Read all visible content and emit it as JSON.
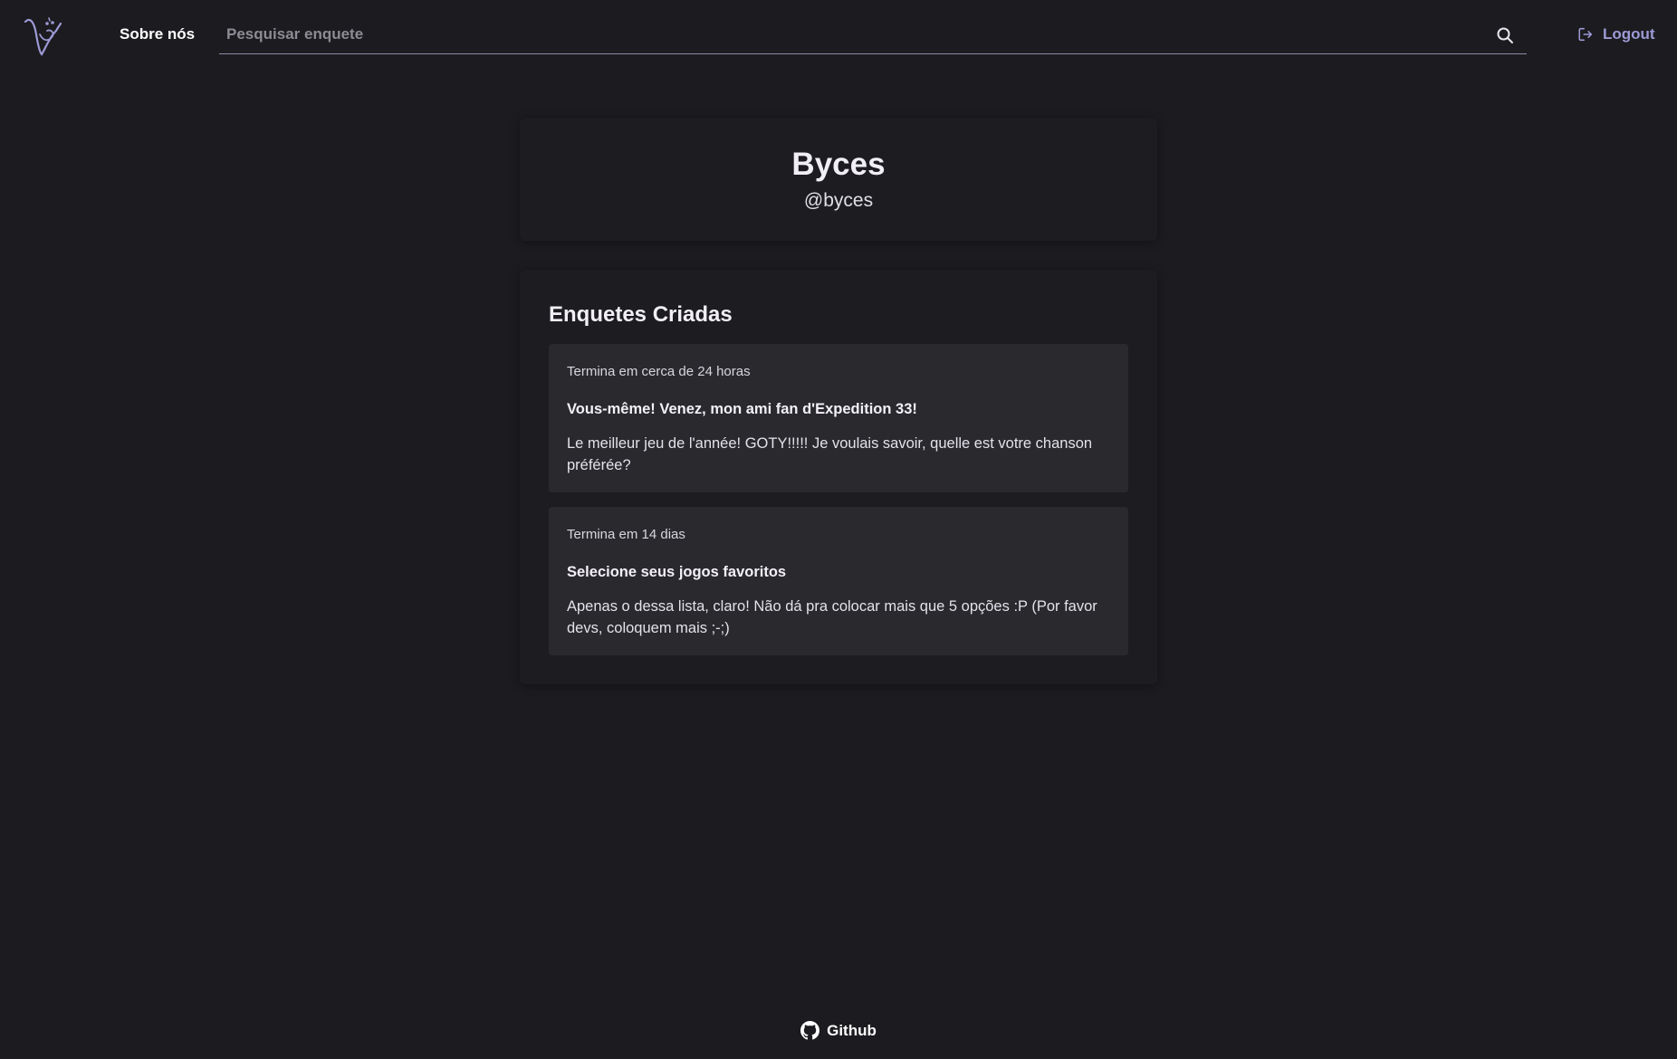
{
  "header": {
    "logo_icon": "vote-logo-icon",
    "nav_about": "Sobre nós",
    "search": {
      "placeholder": "Pesquisar enquete",
      "value": "",
      "icon": "search-icon"
    },
    "logout": {
      "label": "Logout",
      "icon": "logout-icon"
    }
  },
  "profile": {
    "name": "Byces",
    "handle": "@byces"
  },
  "polls": {
    "title": "Enquetes Criadas",
    "items": [
      {
        "meta": "Termina em cerca de 24 horas",
        "title": "Vous-même! Venez, mon ami fan d'Expedition 33!",
        "description": "Le meilleur jeu de l'année! GOTY!!!!! Je voulais savoir, quelle est votre chanson préférée?"
      },
      {
        "meta": "Termina em 14 dias",
        "title": "Selecione seus jogos favoritos",
        "description": "Apenas o dessa lista, claro! Não dá pra colocar mais que 5 opções :P (Por favor devs, coloquem mais ;-;)"
      }
    ]
  },
  "footer": {
    "github_label": "Github",
    "github_icon": "github-icon"
  },
  "colors": {
    "background": "#1c1b1f",
    "card": "#1d1c20",
    "poll_card": "#2a292e",
    "accent": "#9d9ad6"
  }
}
